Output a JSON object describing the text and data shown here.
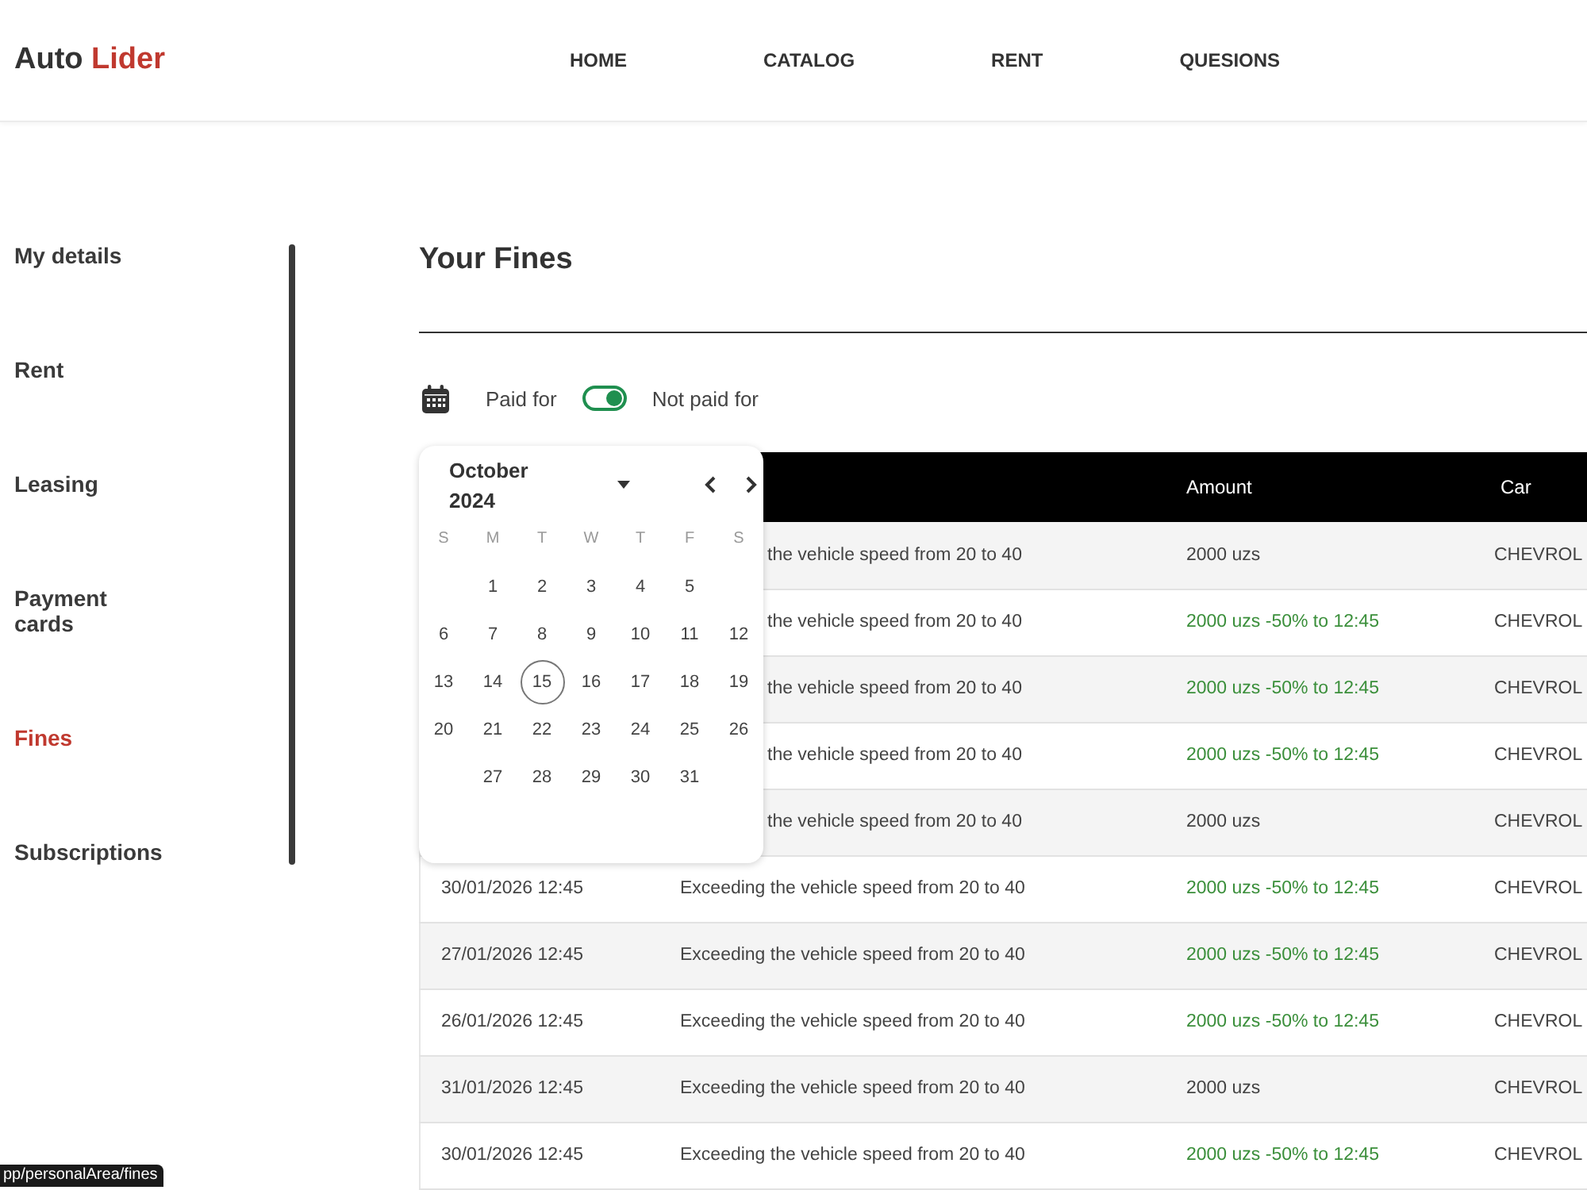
{
  "header": {
    "logo": {
      "text": "Auto",
      "accent": "Lider"
    },
    "nav": [
      "HOME",
      "CATALOG",
      "RENT",
      "QUESIONS"
    ]
  },
  "sidebar": {
    "items": [
      {
        "label": "My details",
        "selected": false
      },
      {
        "label": "Rent",
        "selected": false
      },
      {
        "label": "Leasing",
        "selected": false
      },
      {
        "label": "Payment cards",
        "selected": false
      },
      {
        "label": "Fines",
        "selected": true
      },
      {
        "label": "Subscriptions",
        "selected": false
      }
    ]
  },
  "main": {
    "title": "Your Fines",
    "filter": {
      "paid_label": "Paid for",
      "toggle": {
        "on": true
      },
      "unpaid_label": "Not paid for"
    },
    "calendar": {
      "month": "October 2024",
      "weekdays": [
        "S",
        "M",
        "T",
        "W",
        "T",
        "F",
        "S"
      ],
      "weeks": [
        [
          {
            "day": "1",
            "selected": false
          },
          {
            "day": "2",
            "selected": false
          },
          {
            "day": "3",
            "selected": false
          },
          {
            "day": "4",
            "selected": false
          },
          {
            "day": "5",
            "selected": false
          }
        ],
        [
          {
            "day": "6",
            "selected": false
          },
          {
            "day": "7",
            "selected": false
          },
          {
            "day": "8",
            "selected": false
          },
          {
            "day": "9",
            "selected": false
          },
          {
            "day": "10",
            "selected": false
          },
          {
            "day": "11",
            "selected": false
          },
          {
            "day": "12",
            "selected": false
          }
        ],
        [
          {
            "day": "13",
            "selected": false
          },
          {
            "day": "14",
            "selected": false
          },
          {
            "day": "15",
            "selected": true
          },
          {
            "day": "16",
            "selected": false
          },
          {
            "day": "17",
            "selected": false
          },
          {
            "day": "18",
            "selected": false
          },
          {
            "day": "19",
            "selected": false
          }
        ],
        [
          {
            "day": "20",
            "selected": false
          },
          {
            "day": "21",
            "selected": false
          },
          {
            "day": "22",
            "selected": false
          },
          {
            "day": "23",
            "selected": false
          },
          {
            "day": "24",
            "selected": false
          },
          {
            "day": "25",
            "selected": false
          },
          {
            "day": "26",
            "selected": false
          }
        ],
        [
          {
            "day": "27",
            "selected": false
          },
          {
            "day": "28",
            "selected": false
          },
          {
            "day": "29",
            "selected": false
          },
          {
            "day": "30",
            "selected": false
          },
          {
            "day": "31",
            "selected": false
          }
        ]
      ]
    },
    "table": {
      "columns": [
        {
          "label": "Amount"
        },
        {
          "label": "Car"
        }
      ],
      "rows": [
        {
          "description": "the vehicle speed from 20 to 40",
          "amount": "2000 uzs",
          "discounted": false,
          "car": "CHEVROL"
        },
        {
          "description": "the vehicle speed from 20 to 40",
          "amount": "2000 uzs -50% to 12:45",
          "discounted": true,
          "car": "CHEVROL"
        },
        {
          "description": "the vehicle speed from 20 to 40",
          "amount": "2000 uzs -50% to 12:45",
          "discounted": true,
          "car": "CHEVROL"
        },
        {
          "description": "the vehicle speed from 20 to 40",
          "amount": "2000 uzs -50% to 12:45",
          "discounted": true,
          "car": "CHEVROL"
        },
        {
          "description": "the vehicle speed from 20 to 40",
          "amount": "2000 uzs",
          "discounted": false,
          "car": "CHEVROL"
        },
        {
          "date": "30/01/2026 12:45",
          "description": "Exceeding the vehicle speed from 20 to 40",
          "amount": "2000 uzs -50% to 12:45",
          "discounted": true,
          "car": "CHEVROL"
        },
        {
          "date": "27/01/2026 12:45",
          "description": "Exceeding the vehicle speed from 20 to 40",
          "amount": "2000 uzs -50% to 12:45",
          "discounted": true,
          "car": "CHEVROL"
        },
        {
          "date": "26/01/2026 12:45",
          "description": "Exceeding the vehicle speed from 20 to 40",
          "amount": "2000 uzs -50% to 12:45",
          "discounted": true,
          "car": "CHEVROL"
        },
        {
          "date": "31/01/2026 12:45",
          "description": "Exceeding the vehicle speed from 20 to 40",
          "amount": "2000 uzs",
          "discounted": false,
          "car": "CHEVROL"
        },
        {
          "date": "30/01/2026 12:45",
          "description": "Exceeding the vehicle speed from 20 to 40",
          "amount": "2000 uzs -50% to 12:45",
          "discounted": true,
          "car": "CHEVROL"
        }
      ]
    }
  },
  "status_url": "pp/personalArea/fines"
}
